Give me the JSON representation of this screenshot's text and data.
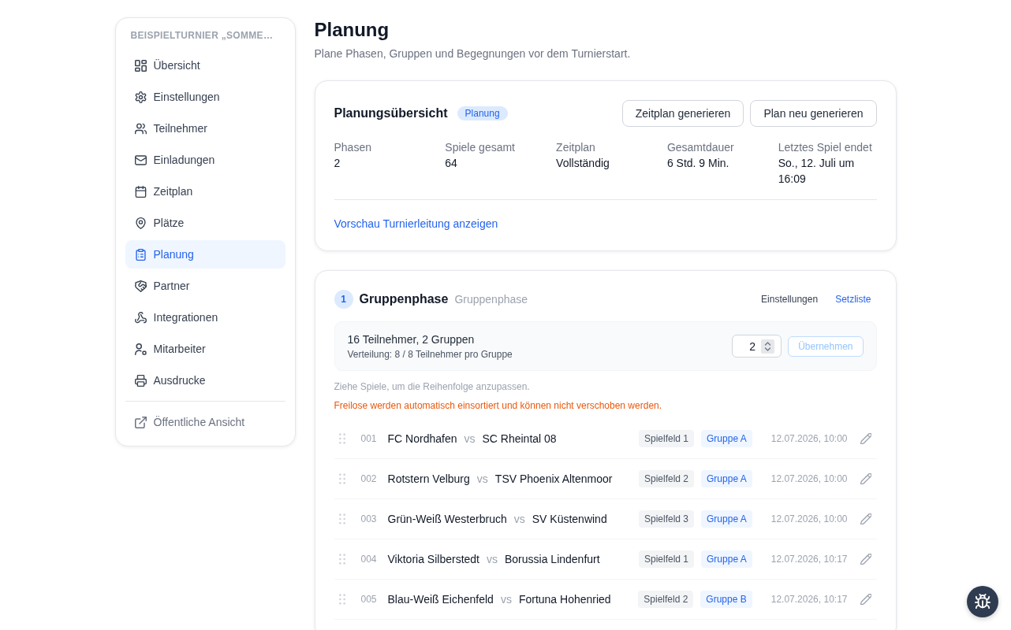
{
  "sidebar": {
    "title": "BEISPIELTURNIER „SOMME…",
    "items": [
      {
        "label": "Übersicht",
        "selected": false
      },
      {
        "label": "Einstellungen",
        "selected": false
      },
      {
        "label": "Teilnehmer",
        "selected": false
      },
      {
        "label": "Einladungen",
        "selected": false
      },
      {
        "label": "Zeitplan",
        "selected": false
      },
      {
        "label": "Plätze",
        "selected": false
      },
      {
        "label": "Planung",
        "selected": true
      },
      {
        "label": "Partner",
        "selected": false
      },
      {
        "label": "Integrationen",
        "selected": false
      },
      {
        "label": "Mitarbeiter",
        "selected": false
      },
      {
        "label": "Ausdrucke",
        "selected": false
      }
    ],
    "footer_link": "Öffentliche Ansicht"
  },
  "header": {
    "title": "Planung",
    "subtitle": "Plane Phasen, Gruppen und Begegnungen vor dem Turnierstart."
  },
  "overview": {
    "title": "Planungsübersicht",
    "status_badge": "Planung",
    "buttons": [
      "Zeitplan generieren",
      "Plan neu generieren"
    ],
    "stats": [
      {
        "label": "Phasen",
        "value": "2"
      },
      {
        "label": "Spiele gesamt",
        "value": "64"
      },
      {
        "label": "Zeitplan",
        "value": "Vollständig"
      },
      {
        "label": "Gesamtdauer",
        "value": "6 Std. 9 Min."
      },
      {
        "label": "Letztes Spiel endet",
        "value": "So., 12. Juli um 16:09"
      }
    ],
    "link": "Vorschau Turnierleitung anzeigen"
  },
  "phase": {
    "number": "1",
    "title": "Gruppenphase",
    "type": "Gruppenphase",
    "actions": [
      {
        "label": "Einstellungen",
        "kind": "plain"
      },
      {
        "label": "Setzliste",
        "kind": "link"
      }
    ],
    "groups": {
      "summary": "16 Teilnehmer, 2 Gruppen",
      "distribution": "Verteilung: 8 / 8 Teilnehmer pro Gruppe",
      "group_count": "2",
      "apply_button": {
        "label": "Übernehmen",
        "disabled": true
      }
    },
    "hint": "Ziehe Spiele, um die Reihenfolge anzupassen.",
    "warning": "Freilose werden automatisch einsortiert und können nicht verschoben werden.",
    "matches": [
      {
        "number": "001",
        "home": "FC Nordhafen",
        "vs": "vs",
        "away": "SC Rheintal 08",
        "field": "Spielfeld 1",
        "group": "Gruppe A",
        "time": "12.07.2026, 10:00"
      },
      {
        "number": "002",
        "home": "Rotstern Velburg",
        "vs": "vs",
        "away": "TSV Phoenix Altenmoor",
        "field": "Spielfeld 2",
        "group": "Gruppe A",
        "time": "12.07.2026, 10:00"
      },
      {
        "number": "003",
        "home": "Grün-Weiß Westerbruch",
        "vs": "vs",
        "away": "SV Küstenwind",
        "field": "Spielfeld 3",
        "group": "Gruppe A",
        "time": "12.07.2026, 10:00"
      },
      {
        "number": "004",
        "home": "Viktoria Silberstedt",
        "vs": "vs",
        "away": "Borussia Lindenfurt",
        "field": "Spielfeld 1",
        "group": "Gruppe A",
        "time": "12.07.2026, 10:17"
      },
      {
        "number": "005",
        "home": "Blau-Weiß Eichenfeld",
        "vs": "vs",
        "away": "Fortuna Hohenried",
        "field": "Spielfeld 2",
        "group": "Gruppe B",
        "time": "12.07.2026, 10:17"
      }
    ]
  }
}
